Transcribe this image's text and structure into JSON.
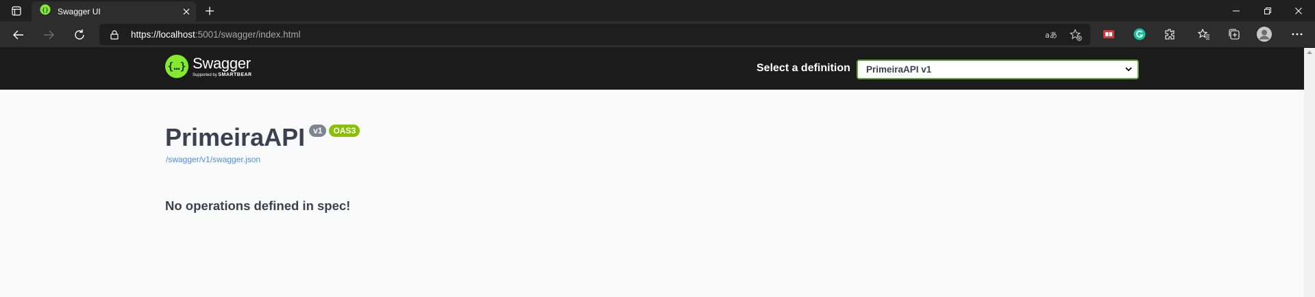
{
  "browser": {
    "tab_title": "Swagger UI",
    "url_host": "https://localhost",
    "url_rest": ":5001/swagger/index.html"
  },
  "header": {
    "logo_name": "Swagger",
    "logo_supported_by": "Supported by",
    "logo_brand": "SMARTBEAR",
    "definition_label": "Select a definition",
    "definition_value": "PrimeiraAPI v1"
  },
  "info": {
    "title": "PrimeiraAPI",
    "version_badge": "v1",
    "oas_badge": "OAS3",
    "spec_link": "/swagger/v1/swagger.json"
  },
  "main": {
    "message": "No operations defined in spec!"
  },
  "colors": {
    "swagger_green": "#85ea2d",
    "oas_badge": "#89bf04",
    "version_badge": "#7d8492",
    "link": "#4990e2",
    "text": "#3b4151"
  }
}
